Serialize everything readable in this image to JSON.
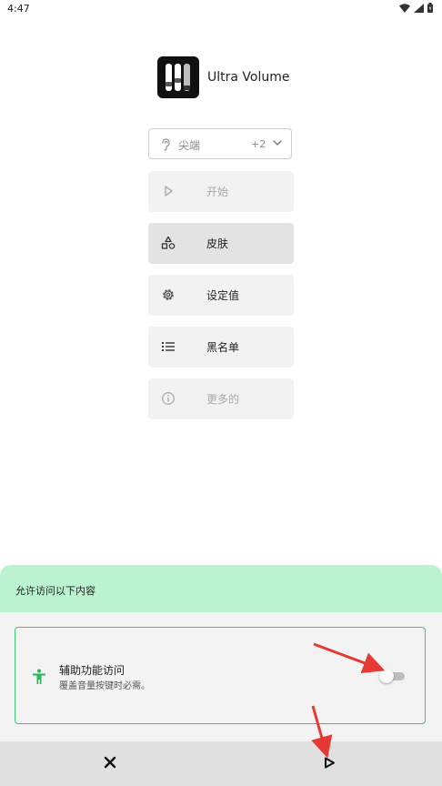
{
  "status_bar": {
    "time": "4:47"
  },
  "app": {
    "title": "Ultra Volume"
  },
  "device_select": {
    "label": "尖端",
    "count": "+2"
  },
  "menu": {
    "start": "开始",
    "skins": "皮肤",
    "settings": "设定值",
    "blacklist": "黑名单",
    "more": "更多的"
  },
  "permission": {
    "header": "允许访问以下内容",
    "item_title": "辅助功能访问",
    "item_desc": "覆盖音量按键时必需。"
  },
  "colors": {
    "accent_green": "#3ec46d",
    "header_green": "#bbf2d0",
    "arrow_red": "#e53935"
  }
}
